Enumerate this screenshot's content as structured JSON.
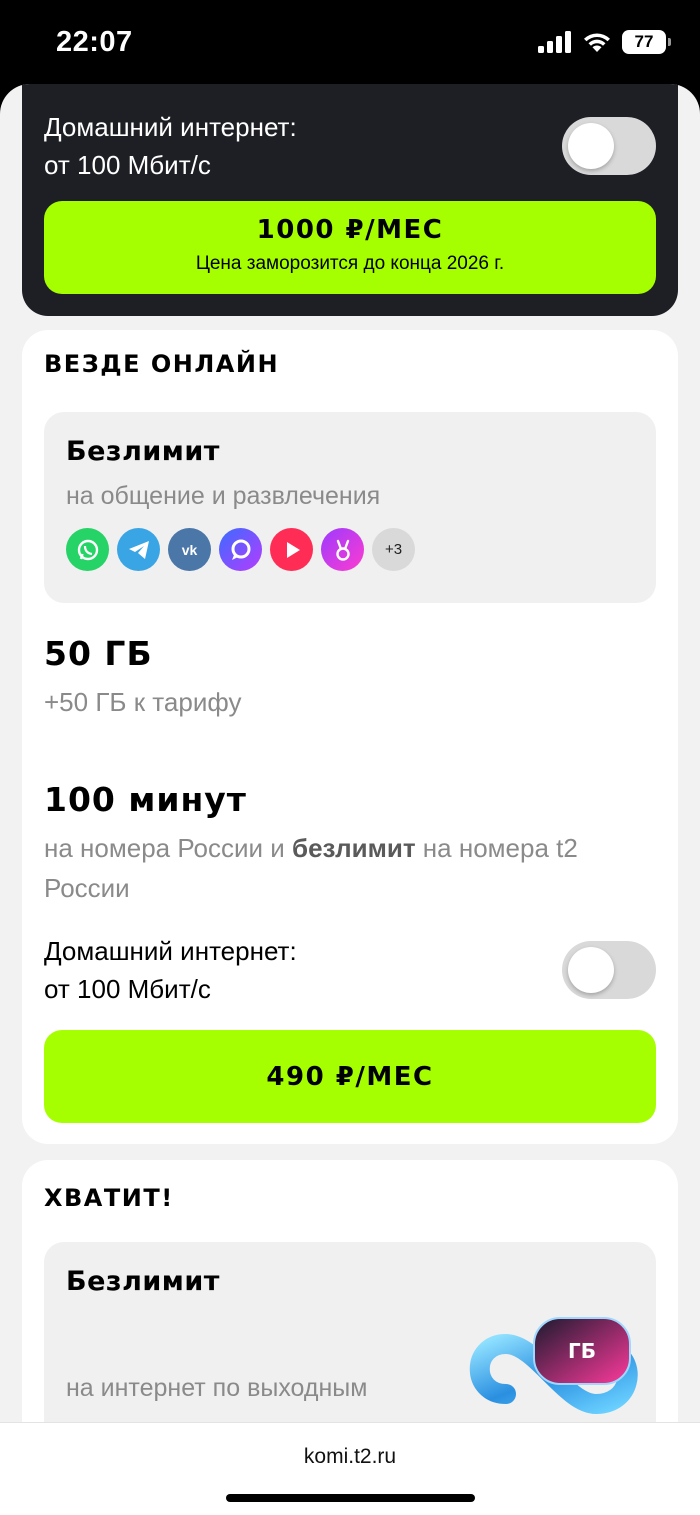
{
  "status_bar": {
    "time": "22:07",
    "battery": "77"
  },
  "top_card": {
    "toggle_label_line1": "Домашний интернет:",
    "toggle_label_line2": "от 100 Мбит/с",
    "price": "1000 ₽/МЕС",
    "price_note": "Цена заморозится до конца 2026 г."
  },
  "plan_everywhere": {
    "title": "ВЕЗДЕ ОНЛАЙН",
    "unlimited_title": "Безлимит",
    "unlimited_sub": "на общение и развлечения",
    "apps": [
      "whatsapp-icon",
      "telegram-icon",
      "vk-icon",
      "max-icon",
      "rutube-icon",
      "vk-clips-icon"
    ],
    "apps_more": "+3",
    "data_amount": "50 ГБ",
    "data_extra": "+50 ГБ к тарифу",
    "minutes": "100 минут",
    "minutes_desc_a": "на номера России и ",
    "minutes_desc_bold": "безлимит",
    "minutes_desc_b": " на номера t2 России",
    "toggle_label_line1": "Домашний интернет:",
    "toggle_label_line2": "от 100 Мбит/с",
    "price": "490 ₽/МЕС"
  },
  "plan_enough": {
    "title": "ХВАТИТ!",
    "unlimited_title": "Безлимит",
    "unlimited_sub": "на интернет по выходным",
    "badge_text": "ГБ"
  },
  "browser": {
    "url": "komi.t2.ru"
  },
  "colors": {
    "accent": "#a5ff00",
    "dark_card": "#1e1f25"
  }
}
